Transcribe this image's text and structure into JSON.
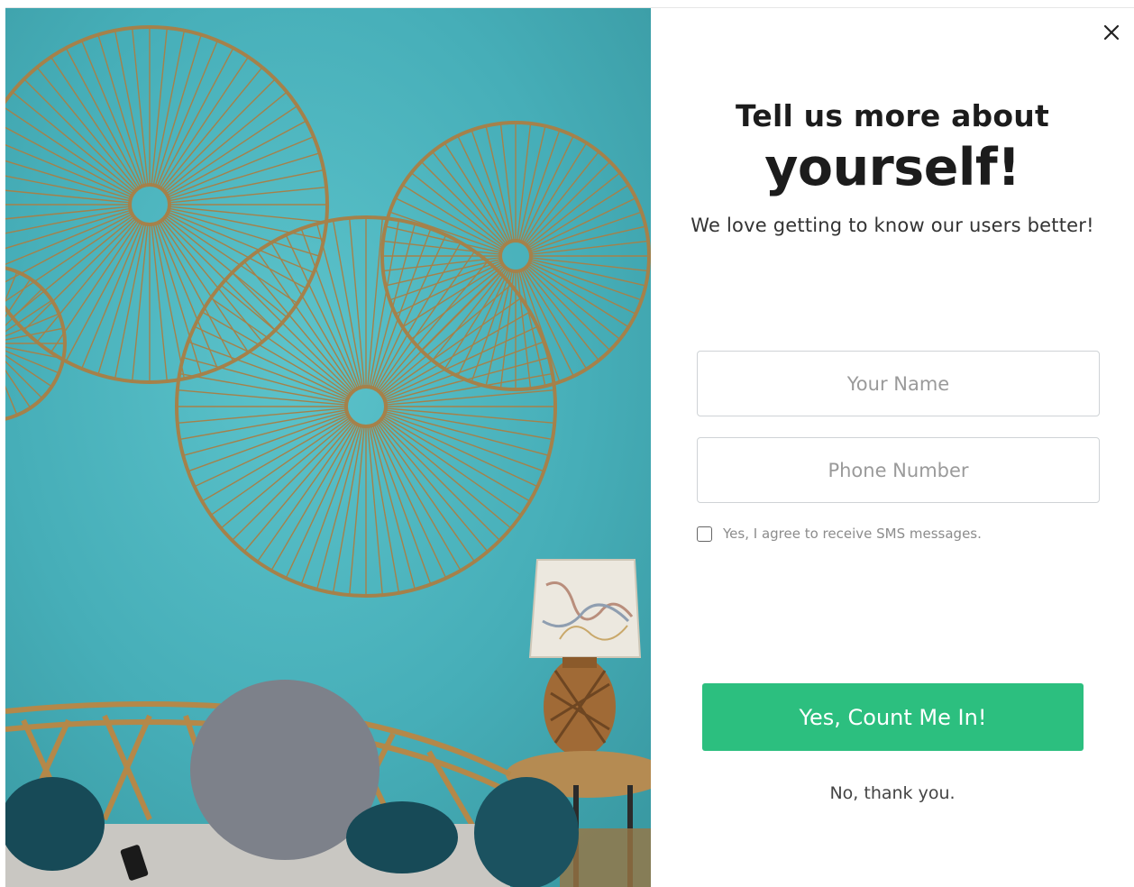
{
  "popup": {
    "heading_line1": "Tell us more about",
    "heading_line2": "yourself!",
    "subtitle": "We love getting to know our users better!",
    "name_placeholder": "Your Name",
    "phone_placeholder": "Phone Number",
    "consent_label": "Yes, I agree to receive SMS messages.",
    "consent_checked": false,
    "submit_label": "Yes, Count Me In!",
    "decline_label": "No, thank you.",
    "close_icon": "close-icon"
  },
  "colors": {
    "accent": "#2cbf7f",
    "wall": "#47b2bd",
    "rings": "#a5814a"
  }
}
